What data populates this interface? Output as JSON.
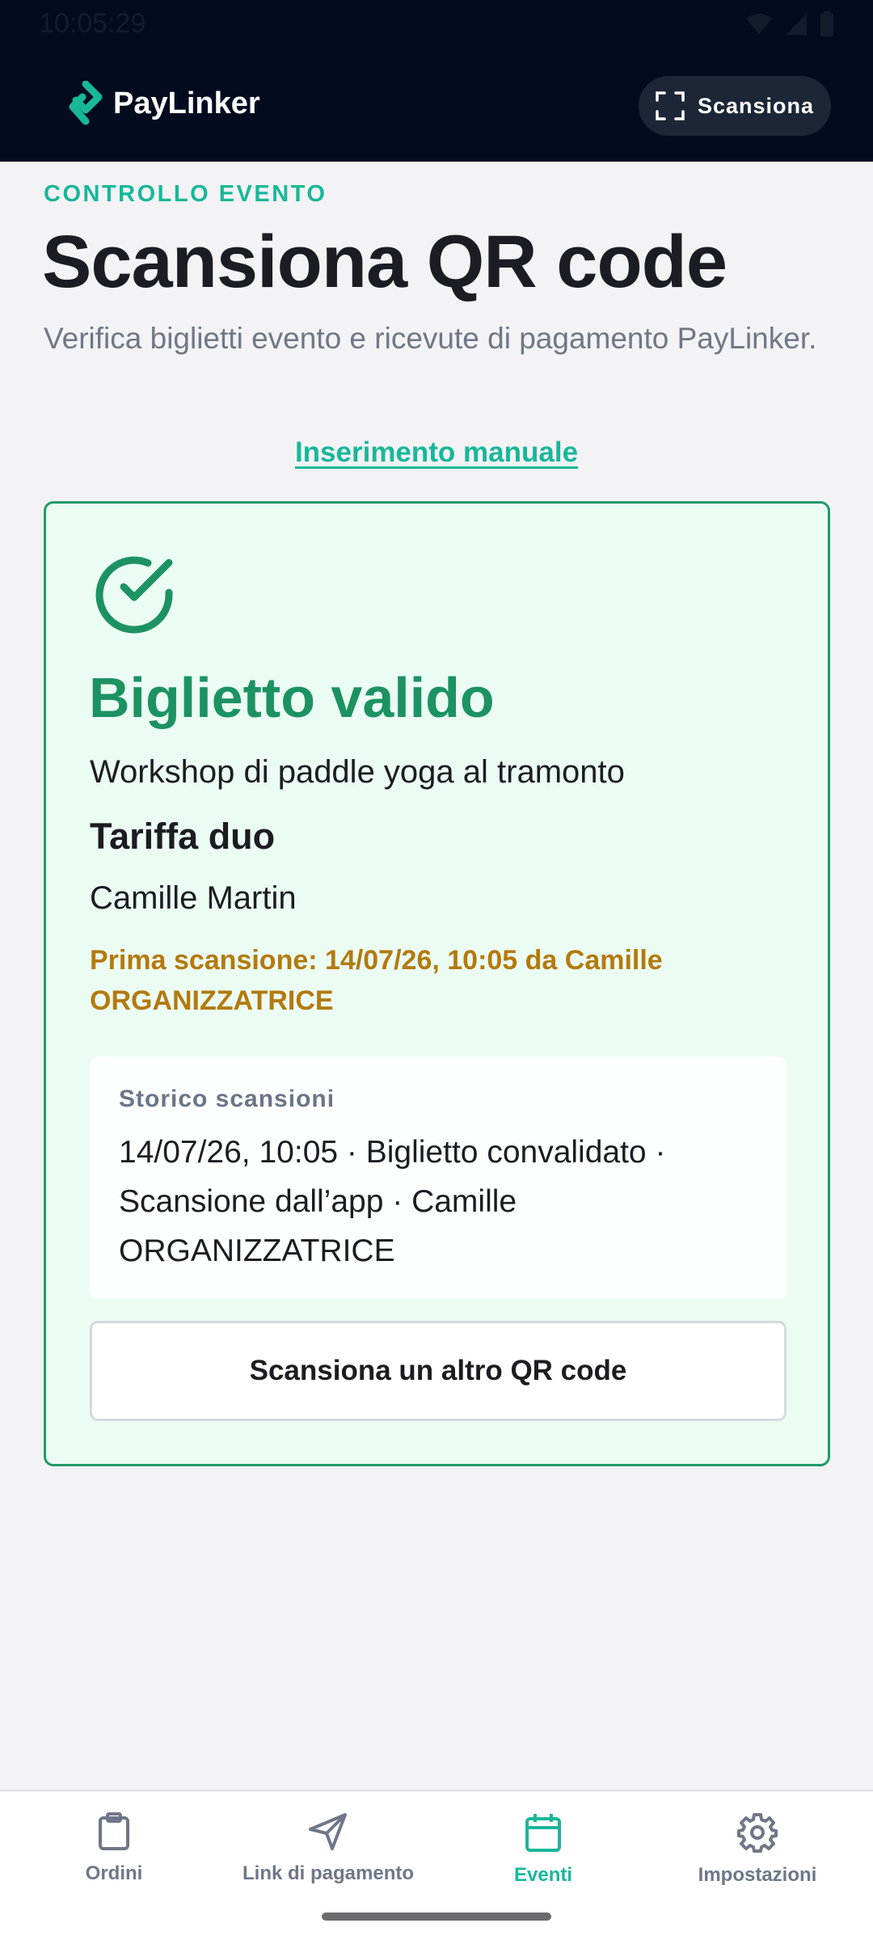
{
  "status_bar": {
    "time": "10:05:29"
  },
  "app": {
    "name": "PayLinker",
    "scan_button": "Scansiona"
  },
  "page": {
    "eyebrow": "CONTROLLO EVENTO",
    "title": "Scansiona QR code",
    "subtitle": "Verifica biglietti evento e ricevute di pagamento PayLinker.",
    "manual_link": "Inserimento manuale"
  },
  "result": {
    "title": "Biglietto valido",
    "event": "Workshop di paddle yoga al tramonto",
    "tariff": "Tariffa duo",
    "holder": "Camille Martin",
    "first_scan": "Prima scansione: 14/07/26, 10:05 da Camille ORGANIZZATRICE",
    "history_title": "Storico scansioni",
    "history_entry": "14/07/26, 10:05 · Biglietto convalidato · Scansione dall’app · Camille ORGANIZZATRICE",
    "scan_again": "Scansiona un altro QR code"
  },
  "nav": [
    {
      "label": "Ordini",
      "icon": "clipboard-icon"
    },
    {
      "label": "Link di pagamento",
      "icon": "send-icon"
    },
    {
      "label": "Eventi",
      "icon": "calendar-icon",
      "active": true
    },
    {
      "label": "Impostazioni",
      "icon": "gear-icon"
    }
  ],
  "colors": {
    "accent": "#18b79a",
    "success": "#1c9263",
    "warning": "#b37a0e",
    "header": "#030c1f"
  }
}
